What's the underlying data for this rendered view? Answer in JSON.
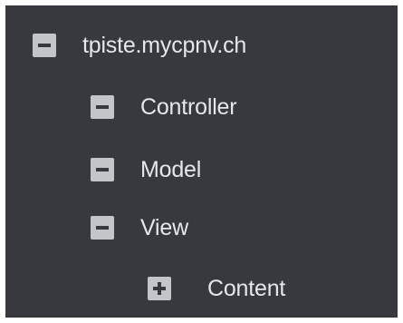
{
  "tree": {
    "root": {
      "label": "tpiste.mycpnv.ch",
      "state": "expanded",
      "icon": "collapse-icon",
      "children": [
        {
          "label": "Controller",
          "state": "expanded",
          "icon": "collapse-icon"
        },
        {
          "label": "Model",
          "state": "expanded",
          "icon": "collapse-icon"
        },
        {
          "label": "View",
          "state": "expanded",
          "icon": "collapse-icon",
          "children": [
            {
              "label": "Content",
              "state": "collapsed",
              "icon": "expand-icon"
            }
          ]
        }
      ]
    }
  },
  "colors": {
    "panel_background": "#37393e",
    "toggle_background": "#c3c5c9",
    "toggle_glyph": "#37393e",
    "label_text": "#e6e7ea"
  }
}
